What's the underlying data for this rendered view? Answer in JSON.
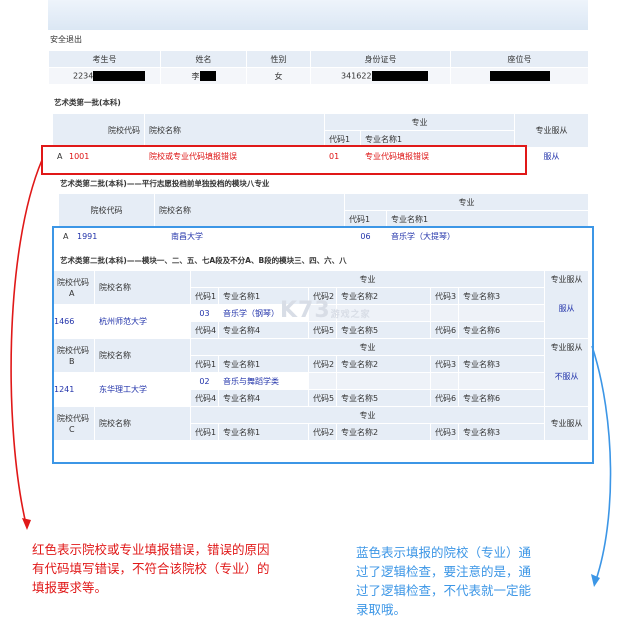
{
  "header": {
    "logout": "安全退出"
  },
  "student": {
    "columns": [
      "考生号",
      "姓名",
      "性别",
      "身份证号",
      "座位号"
    ],
    "values": [
      "2234",
      "李",
      "女",
      "341622",
      ""
    ]
  },
  "batch1": {
    "title": "艺术类第一批(本科)",
    "col_school_code": "院校代码",
    "col_school_name": "院校名称",
    "col_major": "专业",
    "col_code1": "代码1",
    "col_major_name1": "专业名称1",
    "col_obey": "专业服从",
    "row": {
      "letter": "A",
      "school_code": "1001",
      "school_name": "院校或专业代码填报错误",
      "code1": "01",
      "major1": "专业代码填报错误",
      "obey": "服从"
    }
  },
  "batch2_parallel": {
    "title": "艺术类第二批(本科)——平行志愿投档前单独投档的模块八专业",
    "col_school_code": "院校代码",
    "col_school_name": "院校名称",
    "col_major": "专业",
    "col_code1": "代码1",
    "col_major_name1": "专业名称1",
    "row": {
      "letter": "A",
      "school_code": "1991",
      "school_name": "南昌大学",
      "code1": "06",
      "major1": "音乐学（大提琴）"
    }
  },
  "batch2_modules": {
    "title": "艺术类第二批(本科)——模块一、二、五、七A段及不分A、B段的模块三、四、六、八",
    "col_school_code": "院校代码",
    "col_school_name": "院校名称",
    "col_major": "专业",
    "col_obey": "专业服从",
    "code_labels": [
      "代码1",
      "代码2",
      "代码3",
      "代码4",
      "代码5",
      "代码6"
    ],
    "name_labels": [
      "专业名称1",
      "专业名称2",
      "专业名称3",
      "专业名称4",
      "专业名称5",
      "专业名称6"
    ],
    "schools": [
      {
        "letter": "A",
        "code": "1466",
        "name": "杭州师范大学",
        "major_code1": "03",
        "major_name1": "音乐学（钢琴）",
        "obey": "服从"
      },
      {
        "letter": "B",
        "code": "1241",
        "name": "东华理工大学",
        "major_code1": "02",
        "major_name1": "音乐与舞蹈学类",
        "obey": "不服从"
      },
      {
        "letter": "C",
        "code": "",
        "name": "",
        "major_code1": "",
        "major_name1": "",
        "obey": ""
      }
    ]
  },
  "notes": {
    "red": [
      "红色表示院校或专业填报错误，错误的原因",
      "有代码填写错误，不符合该院校（专业）的",
      "填报要求等。"
    ],
    "blue": [
      "蓝色表示填报的院校（专业）通",
      "过了逻辑检查，要注意的是，通",
      "过了逻辑检查，不代表就一定能",
      "录取哦。"
    ]
  },
  "watermark": {
    "main": "K73",
    "sub": "游戏之家"
  },
  "colors": {
    "error": "#e01818",
    "pass": "#3c96e6",
    "header_bg": "#e6edf6"
  }
}
